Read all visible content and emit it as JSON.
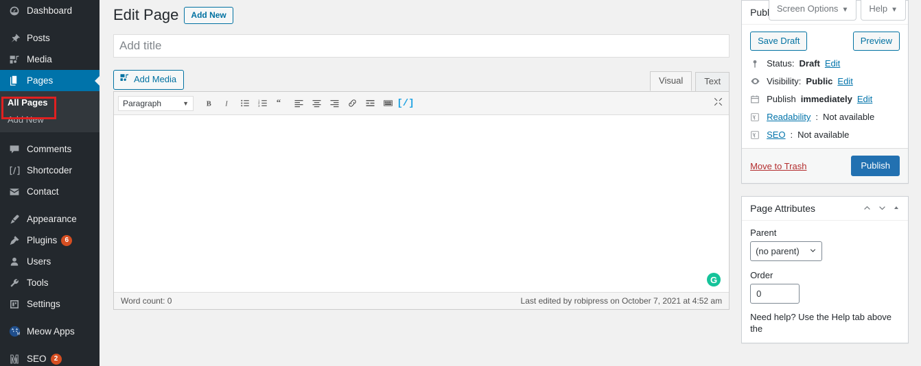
{
  "sidebar": {
    "items": [
      {
        "label": "Dashboard",
        "icon": "dashboard-icon",
        "name": "dashboard",
        "active": false
      },
      {
        "label": "Posts",
        "icon": "pin-icon",
        "name": "posts",
        "active": false
      },
      {
        "label": "Media",
        "icon": "media-icon",
        "name": "media",
        "active": false
      },
      {
        "label": "Pages",
        "icon": "pages-icon",
        "name": "pages",
        "active": true
      },
      {
        "label": "Comments",
        "icon": "comments-icon",
        "name": "comments",
        "active": false
      },
      {
        "label": "Shortcoder",
        "icon": "shortcode-icon",
        "name": "shortcoder",
        "active": false
      },
      {
        "label": "Contact",
        "icon": "envelope-icon",
        "name": "contact",
        "active": false
      },
      {
        "label": "Appearance",
        "icon": "brush-icon",
        "name": "appearance",
        "active": false
      },
      {
        "label": "Plugins",
        "icon": "plug-icon",
        "name": "plugins",
        "active": false,
        "badge": "6"
      },
      {
        "label": "Users",
        "icon": "user-icon",
        "name": "users",
        "active": false
      },
      {
        "label": "Tools",
        "icon": "wrench-icon",
        "name": "tools",
        "active": false
      },
      {
        "label": "Settings",
        "icon": "settings-icon",
        "name": "settings",
        "active": false
      },
      {
        "label": "Meow Apps",
        "icon": "meow-apps-icon",
        "name": "meow-apps",
        "active": false
      },
      {
        "label": "SEO",
        "icon": "yoast-icon",
        "name": "seo",
        "active": false,
        "badge": "2"
      }
    ],
    "submenu": [
      {
        "label": "All Pages",
        "current": true,
        "highlighted": true
      },
      {
        "label": "Add New",
        "current": false,
        "highlighted": false
      }
    ]
  },
  "screen_meta": {
    "screen_options": "Screen Options",
    "help": "Help",
    "caret": "▼"
  },
  "page": {
    "title": "Edit Page",
    "add_new": "Add New",
    "title_placeholder": "Add title",
    "title_value": ""
  },
  "editor": {
    "add_media": "Add Media",
    "tabs": [
      {
        "label": "Visual",
        "active": true
      },
      {
        "label": "Text",
        "active": false
      }
    ],
    "format_select": "Paragraph",
    "toolbar_buttons": [
      {
        "name": "bold-icon",
        "glyph": "B"
      },
      {
        "name": "italic-icon",
        "glyph": "I"
      },
      {
        "name": "bulleted-list-icon",
        "glyph": ""
      },
      {
        "name": "numbered-list-icon",
        "glyph": ""
      },
      {
        "name": "blockquote-icon",
        "glyph": "“"
      },
      {
        "name": "align-left-icon",
        "glyph": ""
      },
      {
        "name": "align-center-icon",
        "glyph": ""
      },
      {
        "name": "align-right-icon",
        "glyph": ""
      },
      {
        "name": "link-icon",
        "glyph": ""
      },
      {
        "name": "read-more-icon",
        "glyph": ""
      },
      {
        "name": "toolbar-toggle-icon",
        "glyph": ""
      },
      {
        "name": "shortcode-icon",
        "glyph": "[/]"
      }
    ],
    "fullscreen_icon": "fullscreen-icon",
    "content": "",
    "grammarly_glyph": "G",
    "word_count": "Word count: 0",
    "last_edited": "Last edited by robipress on October 7, 2021 at 4:52 am"
  },
  "publish_panel": {
    "title": "Publish",
    "save_draft": "Save Draft",
    "preview": "Preview",
    "rows": [
      {
        "icon": "pin-status-icon",
        "label": "Status:",
        "value": "Draft",
        "link": "Edit"
      },
      {
        "icon": "eye-icon",
        "label": "Visibility:",
        "value": "Public",
        "link": "Edit"
      },
      {
        "icon": "calendar-icon",
        "label": "Publish",
        "value": "immediately",
        "link": "Edit"
      },
      {
        "icon": "yoast-icon",
        "label_link": "Readability",
        "label": ":",
        "value": "Not available",
        "link": ""
      },
      {
        "icon": "yoast-icon",
        "label_link": "SEO",
        "label": ":",
        "value": "Not available",
        "link": ""
      }
    ],
    "move_to_trash": "Move to Trash",
    "publish": "Publish"
  },
  "page_attributes": {
    "title": "Page Attributes",
    "parent_label": "Parent",
    "parent_value": "(no parent)",
    "order_label": "Order",
    "order_value": "0",
    "help_text": "Need help? Use the Help tab above the"
  },
  "colors": {
    "sidebar_bg": "#23282d",
    "submenu_bg": "#32373c",
    "accent_blue": "#0073aa",
    "primary_button": "#2271b1",
    "badge_red": "#d54e21",
    "highlight_red": "#e02020",
    "grammarly_green": "#15c39a"
  }
}
